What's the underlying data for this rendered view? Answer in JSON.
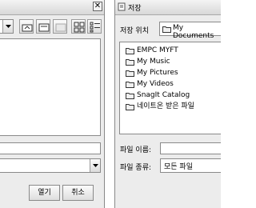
{
  "left_dialog": {
    "close_glyph": "✕",
    "filetype_value": "",
    "open_button": "열기",
    "cancel_button": "취소"
  },
  "right_dialog": {
    "title": "저장",
    "look_in_label": "저장 위치",
    "look_in_value": "My Documents",
    "files": [
      {
        "name": "EMPC MYFT"
      },
      {
        "name": "My Music"
      },
      {
        "name": "My Pictures"
      },
      {
        "name": "My Videos"
      },
      {
        "name": "SnagIt Catalog"
      },
      {
        "name": "네이트온 받은 파일"
      }
    ],
    "filename_label": "파일 이름:",
    "filename_value": "",
    "filetype_label": "파일 종류:",
    "filetype_value": "모든 파일"
  },
  "icons": {
    "folder_color": "#f0f0f0",
    "folder_stroke": "#333333"
  }
}
